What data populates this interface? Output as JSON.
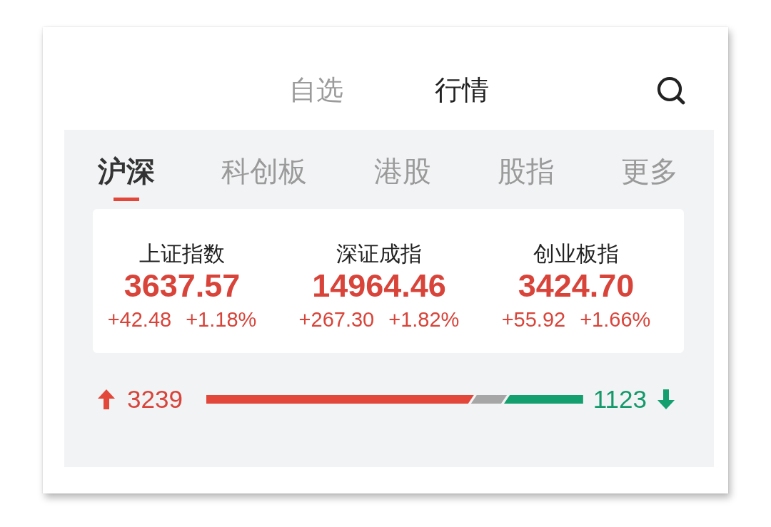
{
  "top_tabs": [
    {
      "label": "自选",
      "selected": false
    },
    {
      "label": "行情",
      "selected": true
    }
  ],
  "market_tabs": [
    {
      "label": "沪深",
      "selected": true
    },
    {
      "label": "科创板",
      "selected": false
    },
    {
      "label": "港股",
      "selected": false
    },
    {
      "label": "股指",
      "selected": false
    },
    {
      "label": "更多",
      "selected": false
    }
  ],
  "indices": [
    {
      "name": "上证指数",
      "value": "3637.57",
      "change": "+42.48",
      "change_pct": "+1.18%"
    },
    {
      "name": "深证成指",
      "value": "14964.46",
      "change": "+267.30",
      "change_pct": "+1.82%"
    },
    {
      "name": "创业板指",
      "value": "3424.70",
      "change": "+55.92",
      "change_pct": "+1.66%"
    }
  ],
  "breadth": {
    "up_count": "3239",
    "down_count": "1123",
    "advancing_bar": {
      "level": 0.71
    },
    "declining_bar": {
      "level": 0.21
    }
  }
}
